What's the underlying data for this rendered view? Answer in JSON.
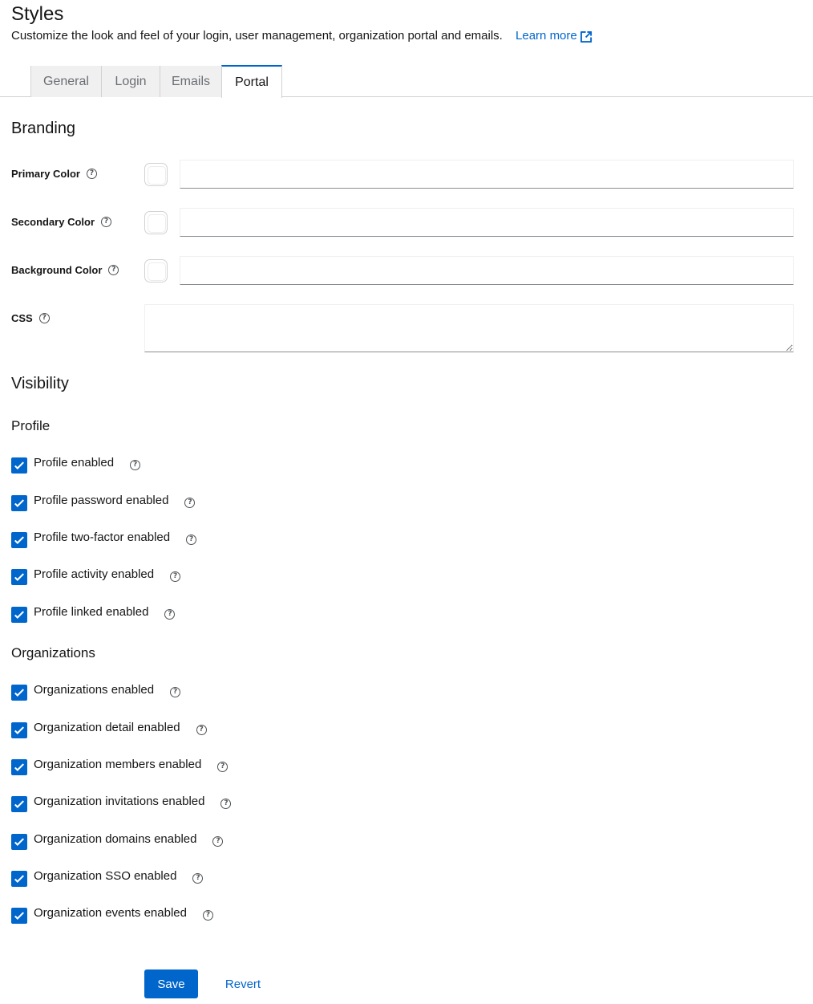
{
  "header": {
    "title": "Styles",
    "description": "Customize the look and feel of your login, user management, organization portal and emails.",
    "learn_more": "Learn more"
  },
  "tabs": [
    {
      "label": "General",
      "active": false
    },
    {
      "label": "Login",
      "active": false
    },
    {
      "label": "Emails",
      "active": false
    },
    {
      "label": "Portal",
      "active": true
    }
  ],
  "branding": {
    "title": "Branding",
    "primary_color": {
      "label": "Primary Color",
      "value": ""
    },
    "secondary_color": {
      "label": "Secondary Color",
      "value": ""
    },
    "background_color": {
      "label": "Background Color",
      "value": ""
    },
    "css": {
      "label": "CSS",
      "value": ""
    }
  },
  "visibility": {
    "title": "Visibility",
    "profile": {
      "title": "Profile",
      "items": [
        {
          "label": "Profile enabled",
          "checked": true
        },
        {
          "label": "Profile password enabled",
          "checked": true
        },
        {
          "label": "Profile two-factor enabled",
          "checked": true
        },
        {
          "label": "Profile activity enabled",
          "checked": true
        },
        {
          "label": "Profile linked enabled",
          "checked": true
        }
      ]
    },
    "organizations": {
      "title": "Organizations",
      "items": [
        {
          "label": "Organizations enabled",
          "checked": true
        },
        {
          "label": "Organization detail enabled",
          "checked": true
        },
        {
          "label": "Organization members enabled",
          "checked": true
        },
        {
          "label": "Organization invitations enabled",
          "checked": true
        },
        {
          "label": "Organization domains enabled",
          "checked": true
        },
        {
          "label": "Organization SSO enabled",
          "checked": true
        },
        {
          "label": "Organization events enabled",
          "checked": true
        }
      ]
    }
  },
  "actions": {
    "save": "Save",
    "revert": "Revert"
  },
  "colors": {
    "accent": "#0066cc",
    "text": "#151515",
    "tab_inactive_bg": "#f0f0f0"
  }
}
